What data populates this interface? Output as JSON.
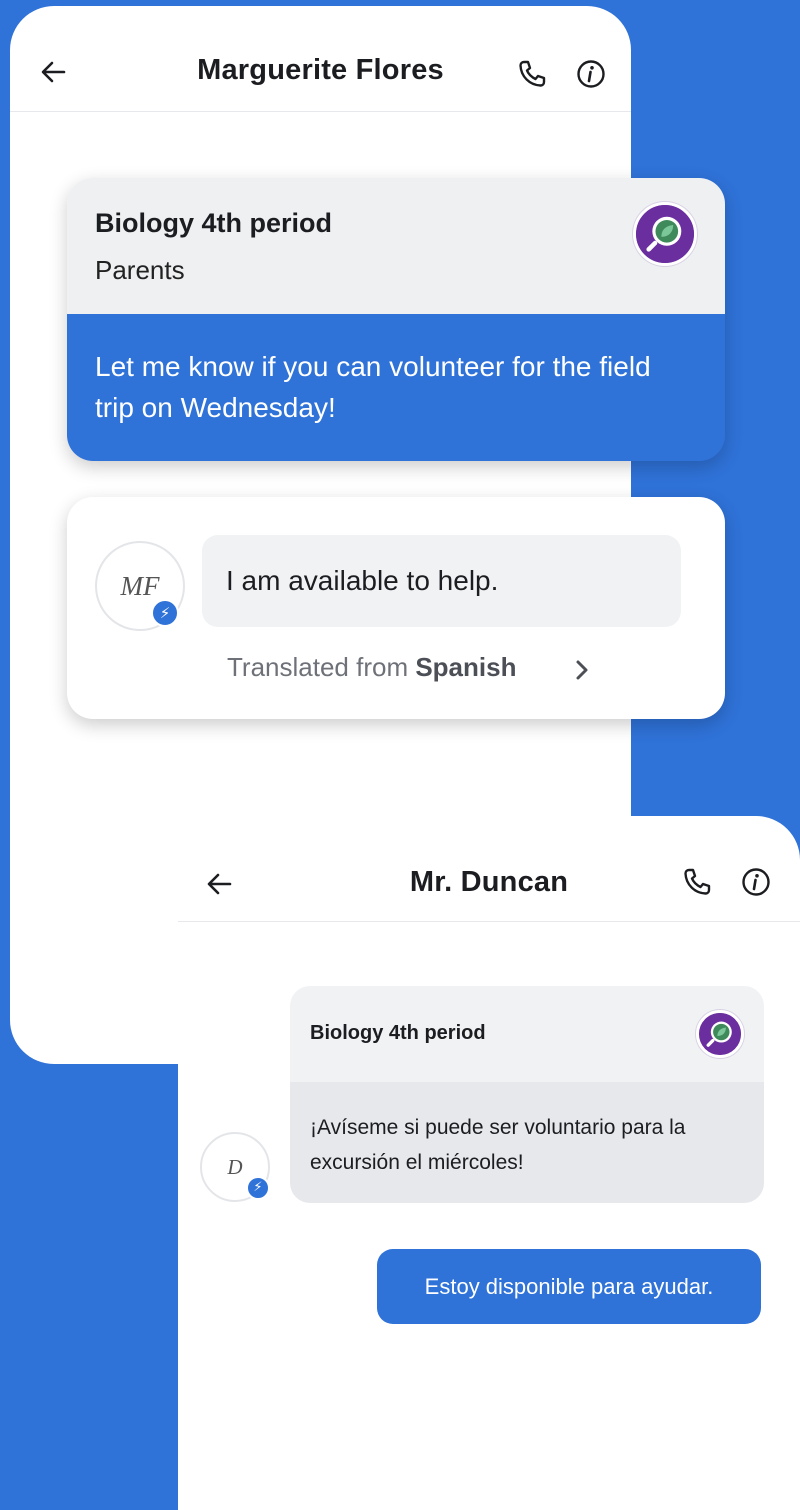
{
  "colors": {
    "brand_blue": "#2f72d8",
    "class_avatar_purple": "#6a2e9e",
    "bubble_gray": "#f0f2f4"
  },
  "parent_view": {
    "header": {
      "title": "Marguerite Flores",
      "back_icon": "arrow-left-icon",
      "call_icon": "phone-icon",
      "info_icon": "info-icon"
    },
    "broadcast": {
      "class_name": "Biology 4th period",
      "audience": "Parents",
      "class_icon": "magnifier-leaf-icon",
      "message": "Let me know if you can volunteer for the field trip on Wednesday!"
    },
    "reply": {
      "avatar_initials": "MF",
      "badge_icon": "lightning-bolt-icon",
      "text": "I am available to help.",
      "translated_prefix": "Translated from ",
      "translated_language": "Spanish",
      "chevron_icon": "chevron-right-icon"
    }
  },
  "teacher_view": {
    "header": {
      "title": "Mr. Duncan",
      "back_icon": "arrow-left-icon",
      "call_icon": "phone-icon",
      "info_icon": "info-icon"
    },
    "received": {
      "class_name": "Biology 4th period",
      "class_icon": "magnifier-leaf-icon",
      "text": "¡Avíseme si puede ser voluntario para la excursión el miércoles!",
      "avatar_initials": "D",
      "badge_icon": "lightning-bolt-icon"
    },
    "sent": {
      "text": "Estoy disponible para ayudar."
    }
  }
}
